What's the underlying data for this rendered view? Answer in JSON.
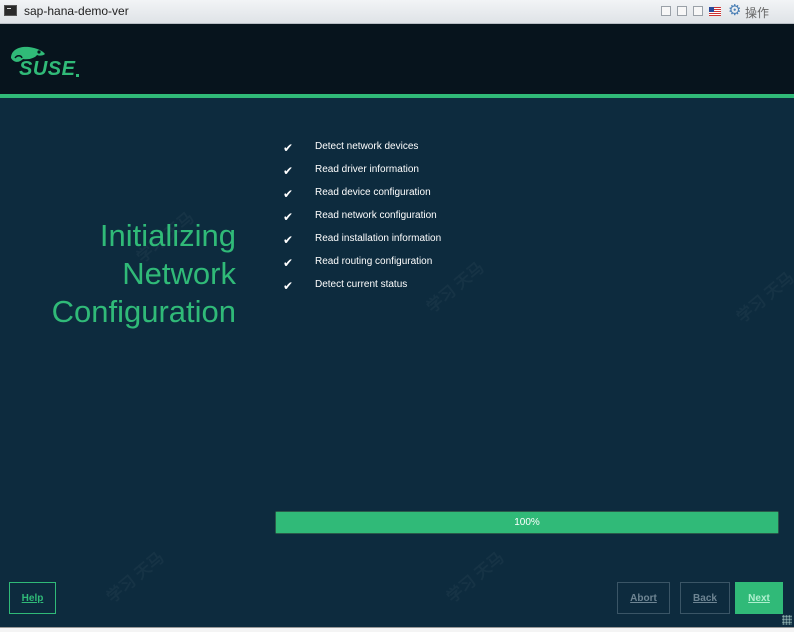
{
  "window": {
    "title": "sap-hana-demo-ver",
    "ops_label": "操作"
  },
  "brand": {
    "logo_text": "SUSE",
    "accent": "#30ba78",
    "background": "#0d2b3e"
  },
  "heading": {
    "lines": [
      "Initializing",
      "Network",
      "Configuration"
    ]
  },
  "tasks": [
    {
      "label": "Detect network devices",
      "done": true
    },
    {
      "label": "Read driver information",
      "done": true
    },
    {
      "label": "Read device configuration",
      "done": true
    },
    {
      "label": "Read network configuration",
      "done": true
    },
    {
      "label": "Read installation information",
      "done": true
    },
    {
      "label": "Read routing configuration",
      "done": true
    },
    {
      "label": "Detect current status",
      "done": true
    }
  ],
  "check_glyph": "✔",
  "progress": {
    "value": 1.0,
    "label": "100%"
  },
  "buttons": {
    "help": "Help",
    "abort": "Abort",
    "back": "Back",
    "next": "Next"
  }
}
